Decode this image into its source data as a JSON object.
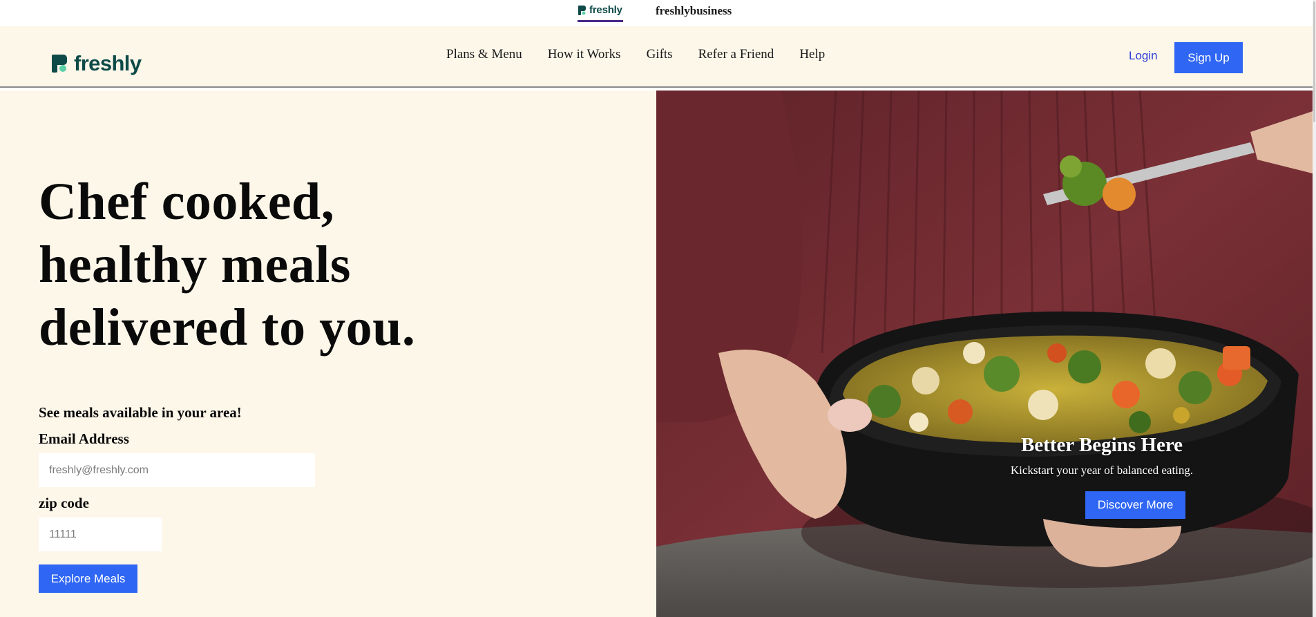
{
  "brand_switcher": {
    "freshly_label": "freshly",
    "business_label": "freshlybusiness"
  },
  "nav": {
    "logo_text": "freshly",
    "links": [
      {
        "label": "Plans & Menu"
      },
      {
        "label": "How it Works"
      },
      {
        "label": "Gifts"
      },
      {
        "label": "Refer a Friend"
      },
      {
        "label": "Help"
      }
    ],
    "login_label": "Login",
    "signup_label": "Sign Up"
  },
  "hero": {
    "headline_line1": "Chef cooked,",
    "headline_line2": "healthy meals",
    "headline_line3": "delivered to you.",
    "sub_prompt": "See meals available in your area!",
    "email_label": "Email Address",
    "email_placeholder": "freshly@freshly.com",
    "email_value": "",
    "zip_label": "zip code",
    "zip_placeholder": "11111",
    "zip_value": "",
    "explore_label": "Explore Meals"
  },
  "promo": {
    "title": "Better Begins Here",
    "subtitle": "Kickstart your year of balanced eating.",
    "button_label": "Discover More"
  },
  "colors": {
    "brand_teal": "#0d4a48",
    "accent_blue": "#2f66f4",
    "cream_bg": "#fdf7ea",
    "tab_underline": "#4a2a8a",
    "login_blue": "#2c3ed8"
  },
  "icons": {
    "logo_mark": "freshly-logo-icon"
  }
}
